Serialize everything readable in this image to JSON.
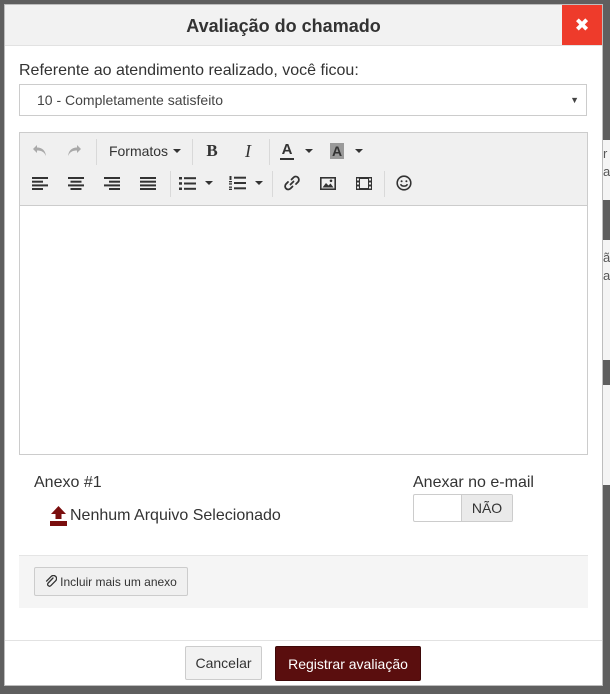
{
  "modal": {
    "title": "Avaliação do chamado",
    "close_glyph": "✖"
  },
  "rating": {
    "label": "Referente ao atendimento realizado, você ficou:",
    "selected": "10 - Completamente satisfeito",
    "caret": "▼"
  },
  "editor": {
    "formats_label": "Formatos",
    "bold": "B",
    "italic": "I",
    "text_color_letter": "A",
    "bg_color_letter": "A",
    "icons": [
      "undo-icon",
      "redo-icon",
      "bold-icon",
      "italic-icon",
      "text-color-icon",
      "background-color-icon",
      "align-left-icon",
      "align-center-icon",
      "align-right-icon",
      "align-justify-icon",
      "bullet-list-icon",
      "numbered-list-icon",
      "link-icon",
      "image-icon",
      "media-icon",
      "emoticon-icon"
    ],
    "content": ""
  },
  "attachment": {
    "title": "Anexo #1",
    "file_label": "Nenhum Arquivo Selecionado",
    "email_label": "Anexar no e-mail",
    "toggle_value": "NÃO",
    "add_label": "Incluir mais um anexo",
    "upload_icon_color": "#7a0e0e"
  },
  "footer": {
    "cancel_label": "Cancelar",
    "submit_label": "Registrar avaliação",
    "submit_color": "#5a0e0e"
  },
  "colors": {
    "close_button": "#ee3b2b",
    "header_bg": "#f2f2f2"
  },
  "backdrop": {
    "fragment_1": "r",
    "fragment_2": "a",
    "fragment_3": "ã",
    "fragment_4": "a"
  }
}
